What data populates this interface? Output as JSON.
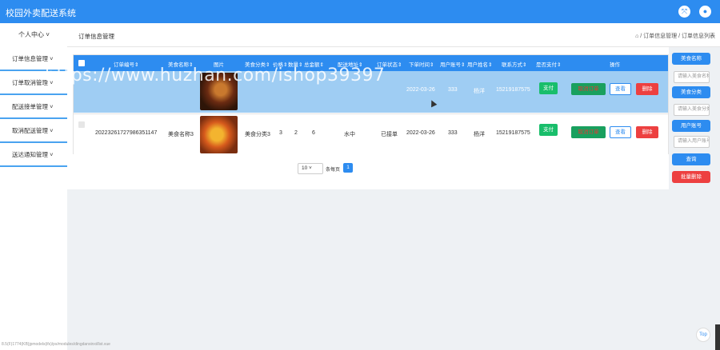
{
  "app": {
    "title": "校园外卖配送系统"
  },
  "sidebar": {
    "head": "个人中心 ˅",
    "items": [
      {
        "label": "订单信息管理 ˅"
      },
      {
        "label": "订单取消管理 ˅"
      },
      {
        "label": "配送接单管理 ˅"
      },
      {
        "label": "取消配送管理 ˅"
      },
      {
        "label": "送达通知管理 ˅"
      }
    ]
  },
  "header": {
    "title": "订单信息管理",
    "breadcrumb": "⌂ / 订单信息管理 / 订单信息列表"
  },
  "table": {
    "columns": [
      "订单编号⇕",
      "美食名称⇕",
      "图片",
      "美食分类⇕",
      "价格⇕",
      "数量⇕",
      "总金额⇕",
      "配送地址⇕",
      "订单状态⇕",
      "下单时间⇕",
      "用户账号⇕",
      "用户姓名⇕",
      "联系方式⇕",
      "是否支付⇕",
      "操作"
    ],
    "rows": [
      {
        "order_no": "",
        "food_name": "",
        "image": "food-photo-1",
        "category": "",
        "price": "",
        "qty": "",
        "total": "",
        "address": "",
        "status": "",
        "time": "2022-03-26",
        "account": "333",
        "name": "杨洋",
        "phone": "15219187575",
        "pay": "支付",
        "btn1": "取消订单",
        "btn2": "查看",
        "btn3": "删除"
      },
      {
        "order_no": "20223261727986351147",
        "food_name": "美食名称3",
        "image": "food-photo-2",
        "category": "美食分类3",
        "price": "3",
        "qty": "2",
        "total": "6",
        "address": "水中",
        "status": "已接单",
        "time": "2022-03-26",
        "account": "333",
        "name": "杨洋",
        "phone": "15219187575",
        "pay": "支付",
        "btn1": "取消订单",
        "btn2": "查看",
        "btn3": "删除"
      }
    ]
  },
  "pager": {
    "page_size": "10",
    "per_page_label": "条每页",
    "page": "1"
  },
  "search_panel": {
    "food_name_btn": "美食名称",
    "food_name_placeholder": "请输入美食名称",
    "category_btn": "美食分类",
    "category_placeholder": "请输入美食分类",
    "account_btn": "用户账号",
    "account_placeholder": "请输入用户账号",
    "search_btn": "查询",
    "batch_delete_btn": "批量删除"
  },
  "watermark": "https://www.huzhan.com/ishop39397",
  "status_url": "8.5(F)1774(KB)jpmodels(ifs)/ps/modules/dingdanxinxi/list.vue",
  "top_label": "Top",
  "colors": {
    "primary": "#2d8cf0",
    "danger": "#ed4040",
    "success": "#19be6b",
    "row_highlight": "#9fcdf3"
  }
}
